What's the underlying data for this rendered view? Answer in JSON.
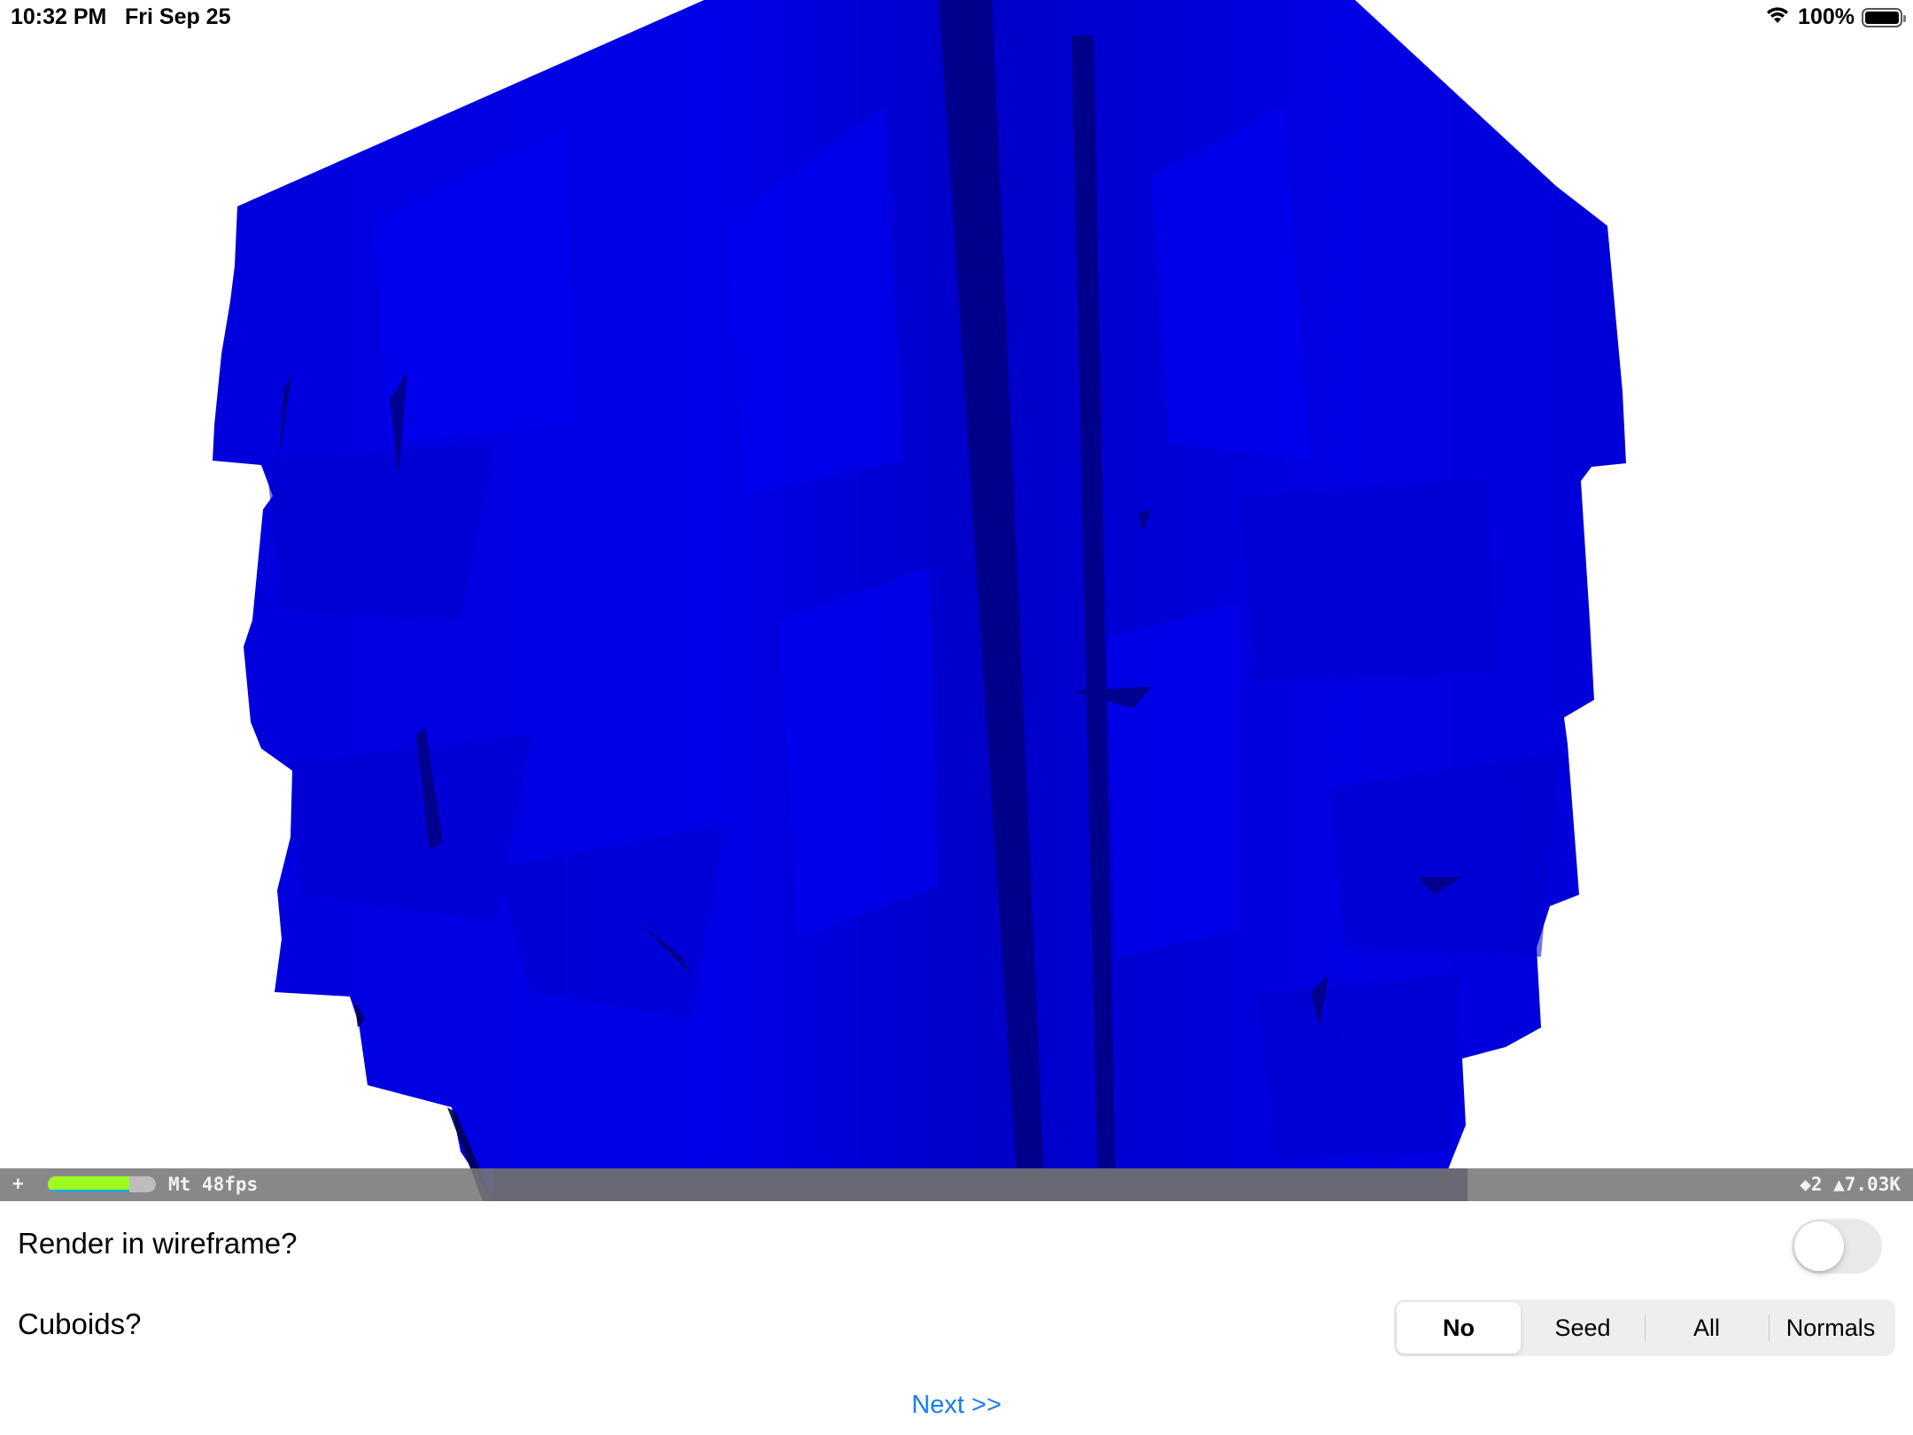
{
  "status_bar": {
    "time": "10:32 PM",
    "date": "Fri Sep 25",
    "battery_percent": "100%",
    "battery_level": 1.0,
    "icons": [
      "wifi-icon",
      "battery-icon"
    ]
  },
  "scene": {
    "mesh_color": "#0000E8",
    "background_color": "#FFFFFF"
  },
  "stats": {
    "plus_label": "+",
    "fps_label": "Mt 48fps",
    "meter_level": 0.75,
    "counts_label": "◆2 ▲7.03K"
  },
  "controls": {
    "wireframe_label": "Render in wireframe?",
    "wireframe_on": false,
    "cuboids_label": "Cuboids?",
    "cuboid_options": [
      "No",
      "Seed",
      "All",
      "Normals"
    ],
    "cuboid_selected": "No"
  },
  "next_label": "Next >>"
}
